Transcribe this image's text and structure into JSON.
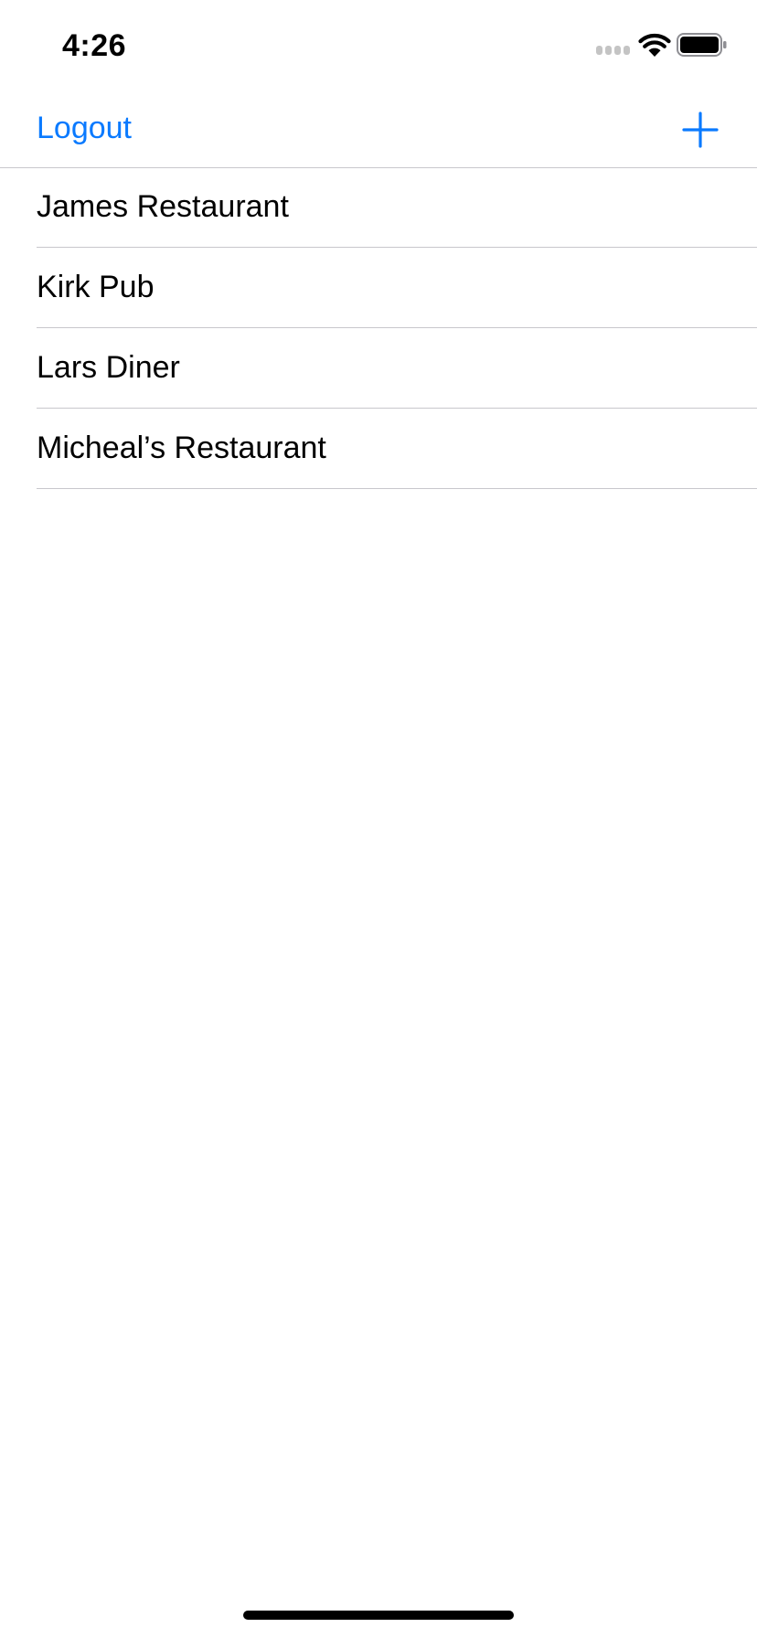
{
  "status_bar": {
    "time": "4:26",
    "icons": [
      "signal-icon",
      "wifi-icon",
      "battery-icon"
    ]
  },
  "nav_bar": {
    "logout_label": "Logout",
    "add_icon": "plus-icon",
    "accent_color": "#0a7aff"
  },
  "restaurants": {
    "items": [
      {
        "label": "James Restaurant"
      },
      {
        "label": "Kirk Pub"
      },
      {
        "label": "Lars Diner"
      },
      {
        "label": "Micheal’s Restaurant"
      }
    ]
  }
}
